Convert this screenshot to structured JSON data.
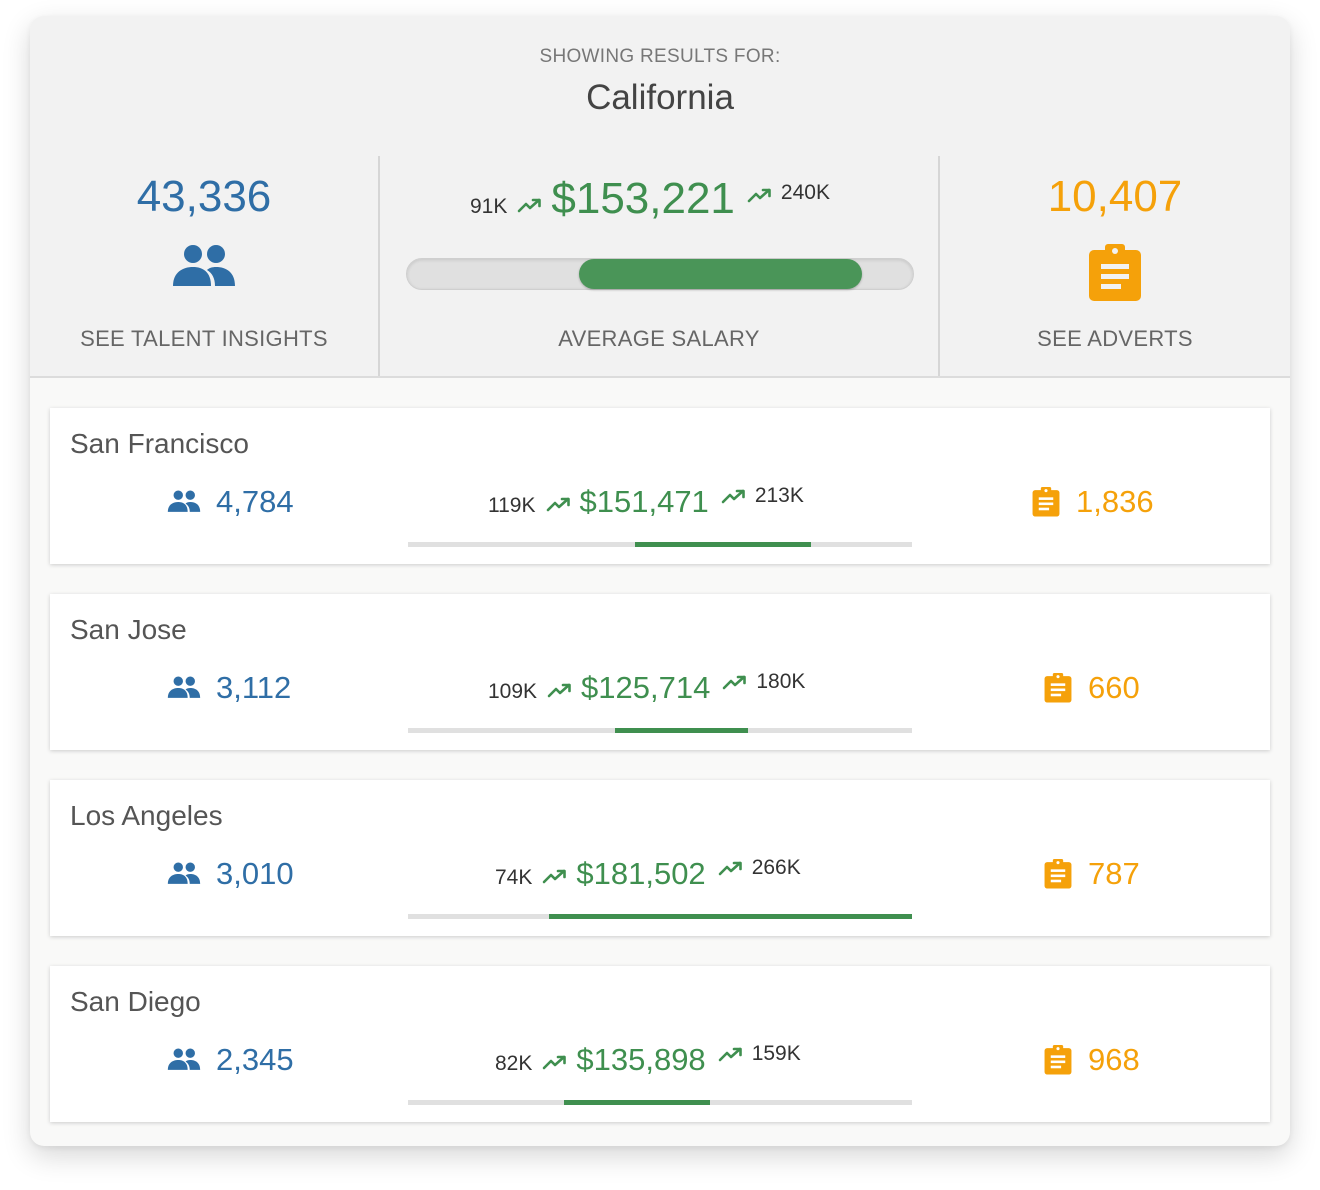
{
  "header": {
    "subtitle": "SHOWING RESULTS FOR:",
    "location": "California"
  },
  "summary": {
    "talent": {
      "count": "43,336",
      "label": "SEE TALENT INSIGHTS",
      "icon": "people-icon",
      "color": "#2f6ea6"
    },
    "salary": {
      "min": "91K",
      "average": "$153,221",
      "max": "240K",
      "label": "AVERAGE SALARY",
      "range_fill": {
        "start": 0.34,
        "end": 0.9
      },
      "color": "#3f8f4f"
    },
    "adverts": {
      "count": "10,407",
      "label": "SEE ADVERTS",
      "icon": "clipboard-icon",
      "color": "#f5a10a"
    }
  },
  "cities": [
    {
      "name": "San Francisco",
      "talent": "4,784",
      "salary_min": "119K",
      "salary_avg": "$151,471",
      "salary_max": "213K",
      "adverts": "1,836",
      "range_fill": {
        "start": 0.45,
        "end": 0.8
      }
    },
    {
      "name": "San Jose",
      "talent": "3,112",
      "salary_min": "109K",
      "salary_avg": "$125,714",
      "salary_max": "180K",
      "adverts": "660",
      "range_fill": {
        "start": 0.41,
        "end": 0.675
      }
    },
    {
      "name": "Los Angeles",
      "talent": "3,010",
      "salary_min": "74K",
      "salary_avg": "$181,502",
      "salary_max": "266K",
      "adverts": "787",
      "range_fill": {
        "start": 0.28,
        "end": 1.0
      }
    },
    {
      "name": "San Diego",
      "talent": "2,345",
      "salary_min": "82K",
      "salary_avg": "$135,898",
      "salary_max": "159K",
      "adverts": "968",
      "range_fill": {
        "start": 0.31,
        "end": 0.6
      }
    }
  ]
}
